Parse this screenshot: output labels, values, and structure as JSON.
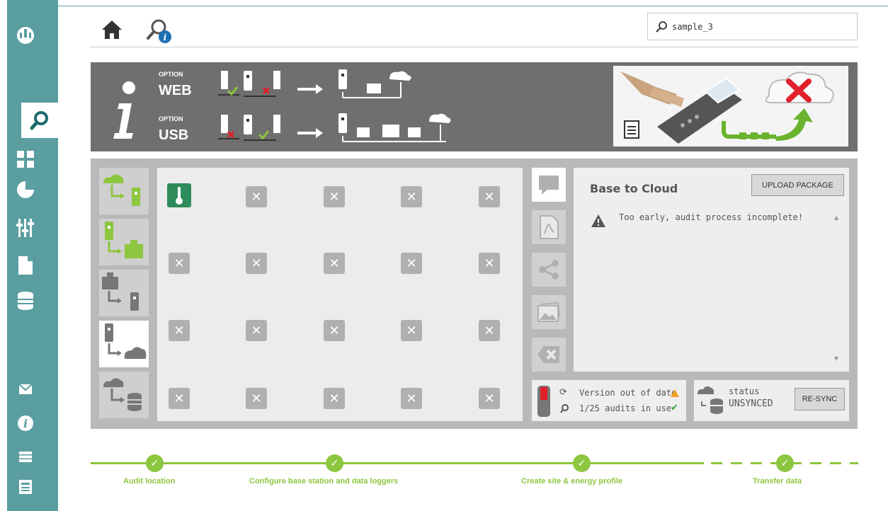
{
  "search": {
    "value": "sample_3"
  },
  "banner": {
    "web_option": "OPTION",
    "web_label": "WEB",
    "usb_option": "OPTION",
    "usb_label": "USB"
  },
  "panel": {
    "title": "Base to Cloud",
    "upload_label": "UPLOAD PACKAGE",
    "warning": "Too early, audit process incomplete!"
  },
  "status": {
    "version_text": "Version out of date",
    "audits_text": "1/25 audits in use",
    "status_label": "status",
    "status_value": "UNSYNCED",
    "resync_label": "RE-SYNC"
  },
  "steps": [
    {
      "label": "Audit location"
    },
    {
      "label": "Configure base station and data loggers"
    },
    {
      "label": "Create site & energy profile"
    },
    {
      "label": "Transfer data"
    }
  ],
  "colors": {
    "teal": "#5a9ea0",
    "green": "#8dc63f",
    "banner": "#6f6f6f",
    "red": "#e0202a"
  }
}
